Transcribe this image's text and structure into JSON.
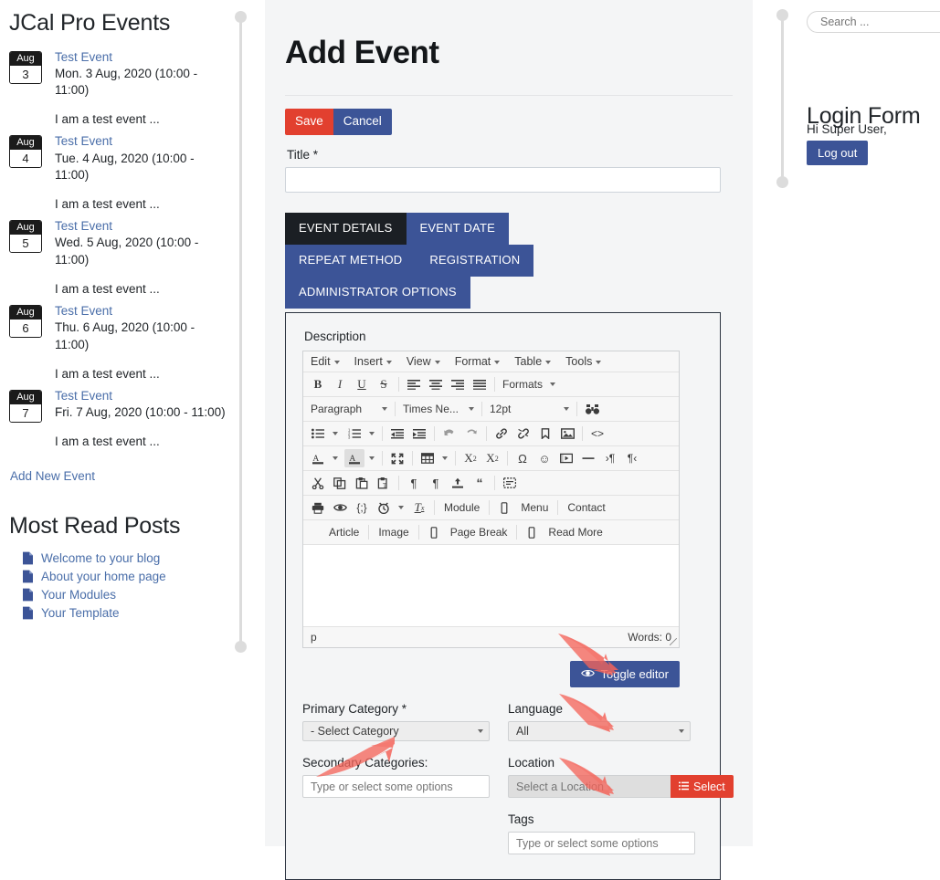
{
  "left_sidebar": {
    "events_module_title": "JCal Pro Events",
    "events": [
      {
        "month": "Aug",
        "day": "3",
        "link": "Test Event",
        "when": "Mon. 3 Aug, 2020 (10:00 - 11:00)",
        "desc": "I am a test event ..."
      },
      {
        "month": "Aug",
        "day": "4",
        "link": "Test Event",
        "when": "Tue. 4 Aug, 2020 (10:00 - 11:00)",
        "desc": "I am a test event ..."
      },
      {
        "month": "Aug",
        "day": "5",
        "link": "Test Event",
        "when": "Wed. 5 Aug, 2020 (10:00 - 11:00)",
        "desc": "I am a test event ..."
      },
      {
        "month": "Aug",
        "day": "6",
        "link": "Test Event",
        "when": "Thu. 6 Aug, 2020 (10:00 - 11:00)",
        "desc": "I am a test event ..."
      },
      {
        "month": "Aug",
        "day": "7",
        "link": "Test Event",
        "when": "Fri. 7 Aug, 2020 (10:00 - 11:00)",
        "desc": "I am a test event ..."
      }
    ],
    "add_new_event": "Add New Event",
    "most_read_title": "Most Read Posts",
    "most_read_posts": [
      {
        "label": "Welcome to your blog",
        "icon": "document-icon"
      },
      {
        "label": "About your home page",
        "icon": "document-icon"
      },
      {
        "label": "Your Modules",
        "icon": "document-icon"
      },
      {
        "label": "Your Template",
        "icon": "document-icon"
      }
    ]
  },
  "main": {
    "page_title": "Add Event",
    "save_label": "Save",
    "cancel_label": "Cancel",
    "title_label": "Title *",
    "title_value": "",
    "tabs": [
      {
        "label": "EVENT DETAILS",
        "active": true
      },
      {
        "label": "EVENT DATE",
        "active": false
      },
      {
        "label": "REPEAT METHOD",
        "active": false
      },
      {
        "label": "REGISTRATION",
        "active": false
      },
      {
        "label": "ADMINISTRATOR OPTIONS",
        "active": false
      }
    ],
    "description_label": "Description",
    "toggle_editor_label": "Toggle editor",
    "toggle_editor_icon": "eye-icon"
  },
  "editor": {
    "menubar": [
      "Edit",
      "Insert",
      "View",
      "Format",
      "Table",
      "Tools"
    ],
    "row1_icons": [
      "bold-icon",
      "italic-icon",
      "underline-icon",
      "strikethrough-icon",
      "align-left-icon",
      "align-center-icon",
      "align-right-icon",
      "align-justify-icon"
    ],
    "formats_label": "Formats",
    "block_format": "Paragraph",
    "font_family": "Times Ne...",
    "font_size": "12pt",
    "search_icon": "binoculars-icon",
    "row3_icons": [
      "bullet-list-icon",
      "numbered-list-icon",
      "outdent-icon",
      "indent-icon",
      "undo-icon",
      "redo-icon",
      "link-icon",
      "unlink-icon",
      "anchor-icon",
      "image-icon",
      "source-code-icon"
    ],
    "row4_icons": [
      "text-color-icon",
      "background-color-icon",
      "fullscreen-icon",
      "table-icon",
      "subscript-icon",
      "superscript-icon",
      "special-character-icon",
      "emoticon-icon",
      "media-icon",
      "horizontal-rule-icon",
      "ltr-icon",
      "rtl-icon"
    ],
    "row5_icons": [
      "cut-icon",
      "copy-icon",
      "paste-icon",
      "paste-text-icon",
      "show-blocks-icon",
      "paragraph-icon",
      "template-icon",
      "blockquote-icon",
      "visual-chars-icon"
    ],
    "row6_icons": [
      "print-icon",
      "preview-icon",
      "code-sample-icon",
      "insert-date-time-icon",
      "clear-formatting-icon"
    ],
    "joomla_buttons": [
      "Module",
      "Menu",
      "Contact",
      "Article",
      "Image",
      "Page Break",
      "Read More"
    ],
    "status_path": "p",
    "status_words": "Words: 0"
  },
  "lower_form": {
    "primary_category_label": "Primary Category *",
    "primary_category_value": "- Select Category",
    "secondary_categories_label": "Secondary Categories:",
    "secondary_categories_placeholder": "Type or select some options",
    "language_label": "Language",
    "language_value": "All",
    "location_label": "Location",
    "location_placeholder": "Select a Location",
    "location_select_button": "Select",
    "location_select_icon": "list-icon",
    "tags_label": "Tags",
    "tags_placeholder": "Type or select some options"
  },
  "right_sidebar": {
    "search_placeholder": "Search ...",
    "login_form_title": "Login Form",
    "greeting": "Hi Super User,",
    "logout_label": "Log out"
  },
  "annotations": {
    "arrow_color": "#f4645a",
    "count": 4
  },
  "colors": {
    "accent_red": "#e2402f",
    "accent_blue": "#3c5497",
    "tab_active": "#1b1f24",
    "link": "#4a6ea9",
    "panel_bg": "#f4f5f6"
  }
}
